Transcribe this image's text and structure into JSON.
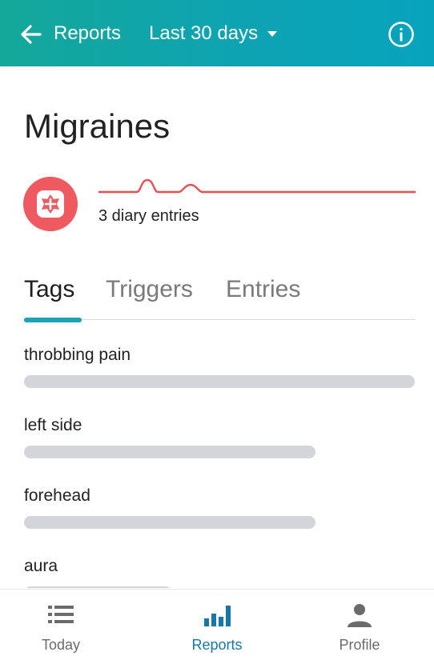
{
  "header": {
    "back_icon": "arrow-left-icon",
    "title": "Reports",
    "range_label": "Last 30 days",
    "range_caret_icon": "caret-down-icon",
    "info_icon": "info-circle-icon"
  },
  "condition": {
    "name": "Migraines",
    "icon": "migraine-head-icon",
    "icon_color": "#ee5a5f",
    "trend_color": "#e85054",
    "entries_text": "3 diary entries"
  },
  "tabs": [
    {
      "label": "Tags",
      "active": true
    },
    {
      "label": "Triggers",
      "active": false
    },
    {
      "label": "Entries",
      "active": false
    }
  ],
  "tags": [
    {
      "label": "throbbing pain",
      "fraction": 1.0
    },
    {
      "label": "left side",
      "fraction": 0.746
    },
    {
      "label": "forehead",
      "fraction": 0.746
    },
    {
      "label": "aura",
      "fraction": 0.38
    }
  ],
  "bottom_nav": [
    {
      "label": "Today",
      "icon": "list-icon",
      "active": false
    },
    {
      "label": "Reports",
      "icon": "bar-chart-icon",
      "active": true
    },
    {
      "label": "Profile",
      "icon": "person-icon",
      "active": false
    }
  ],
  "colors": {
    "accent": "#1aa4b8",
    "active_nav": "#1778a8",
    "bar": "#d4d5da"
  }
}
